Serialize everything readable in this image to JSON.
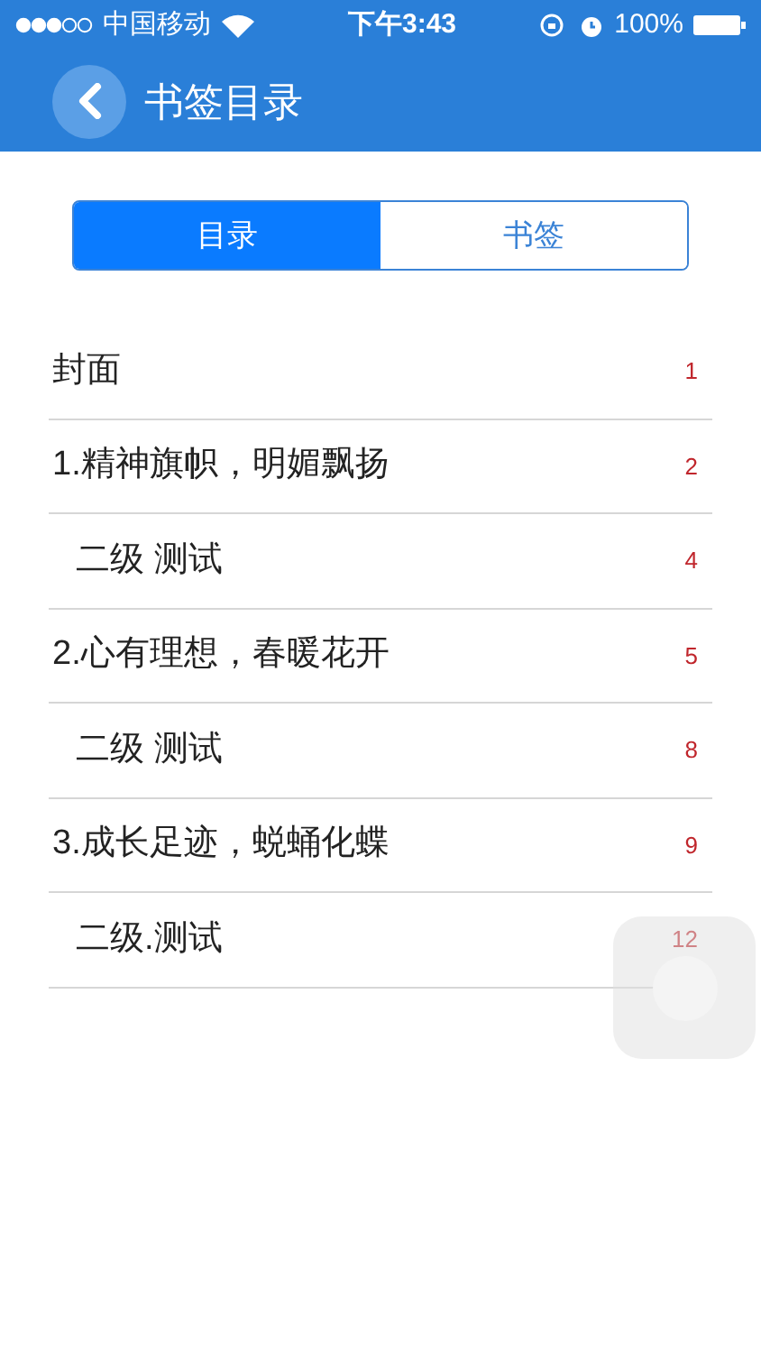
{
  "status_bar": {
    "carrier": "中国移动",
    "time": "下午3:43",
    "battery": "100%"
  },
  "nav_bar": {
    "title": "书签目录"
  },
  "tabs": [
    {
      "label": "目录",
      "selected": true
    },
    {
      "label": "书签",
      "selected": false
    }
  ],
  "toc": [
    {
      "title": "封面",
      "page": "1"
    },
    {
      "title": "1.精神旗帜，明媚飘扬",
      "page": "2",
      "children": [
        {
          "title": "二级 测试",
          "page": "4"
        }
      ]
    },
    {
      "title": "2.心有理想，春暖花开",
      "page": "5",
      "children": [
        {
          "title": "二级 测试",
          "page": "8"
        }
      ]
    },
    {
      "title": "3.成长足迹，蜕蛹化蝶",
      "page": "9",
      "children": [
        {
          "title": "二级.测试",
          "page": "12"
        }
      ]
    }
  ]
}
